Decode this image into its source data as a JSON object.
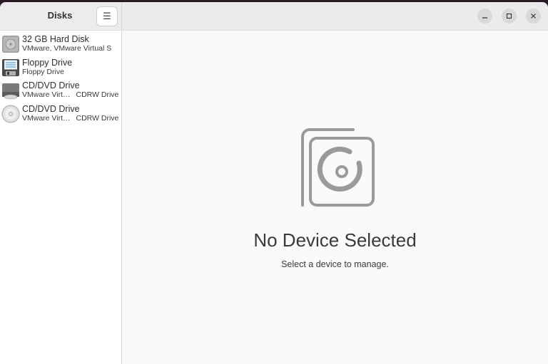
{
  "window": {
    "title": "Disks",
    "menu_icon": "hamburger-icon",
    "controls": [
      "minimize-icon",
      "maximize-icon",
      "close-icon"
    ]
  },
  "sidebar": {
    "devices": [
      {
        "name": "32 GB Hard Disk",
        "sub_a": "VMware, VMware Virtual S",
        "sub_b": "",
        "icon": "hard-disk-icon"
      },
      {
        "name": "Floppy Drive",
        "sub_a": "Floppy Drive",
        "sub_b": "",
        "icon": "floppy-icon"
      },
      {
        "name": "CD/DVD Drive",
        "sub_a": "VMware Virt…",
        "sub_b": "CDRW Drive",
        "icon": "optical-drive-icon"
      },
      {
        "name": "CD/DVD Drive",
        "sub_a": "VMware Virt…",
        "sub_b": "CDRW Drive",
        "icon": "optical-disc-icon"
      }
    ]
  },
  "main": {
    "title": "No Device Selected",
    "subtitle": "Select a device to manage.",
    "icon": "disks-empty-icon"
  }
}
